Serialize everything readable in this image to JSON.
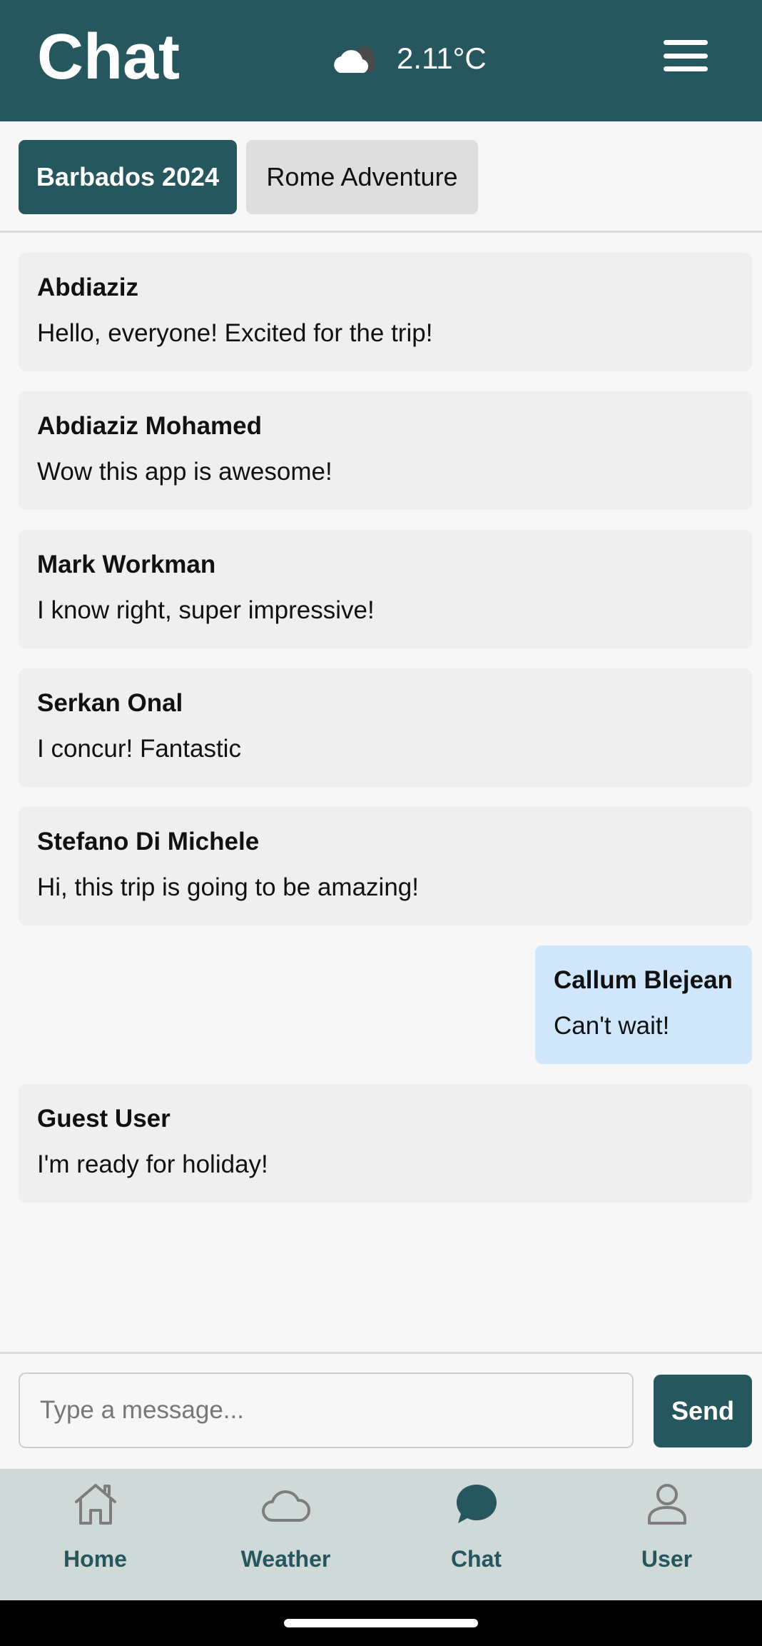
{
  "header": {
    "title": "Chat",
    "weather_icon": "cloud-icon",
    "temperature": "2.11°C",
    "menu_icon": "hamburger-menu-icon"
  },
  "tabs": [
    {
      "label": "Barbados 2024",
      "active": true
    },
    {
      "label": "Rome Adventure",
      "active": false
    }
  ],
  "messages": [
    {
      "sender": "Abdiaziz",
      "text": "Hello, everyone! Excited for the trip!",
      "own": false
    },
    {
      "sender": "Abdiaziz Mohamed",
      "text": "Wow this app is awesome!",
      "own": false
    },
    {
      "sender": "Mark Workman",
      "text": "I know right, super impressive!",
      "own": false
    },
    {
      "sender": "Serkan Onal",
      "text": "I concur! Fantastic",
      "own": false
    },
    {
      "sender": "Stefano Di Michele",
      "text": "Hi, this trip is going to be amazing!",
      "own": false
    },
    {
      "sender": "Callum Blejean",
      "text": "Can't wait!",
      "own": true
    },
    {
      "sender": "Guest User",
      "text": "I'm ready for holiday!",
      "own": false
    }
  ],
  "composer": {
    "placeholder": "Type a message...",
    "value": "",
    "send_label": "Send"
  },
  "bottom_nav": [
    {
      "label": "Home",
      "icon": "home-icon",
      "active": false
    },
    {
      "label": "Weather",
      "icon": "cloud-icon",
      "active": false
    },
    {
      "label": "Chat",
      "icon": "chat-bubble-icon",
      "active": true
    },
    {
      "label": "User",
      "icon": "user-icon",
      "active": false
    }
  ],
  "colors": {
    "primary": "#26575f",
    "own_message_bg": "#cfe6fb",
    "message_bg": "#efefef",
    "nav_bg": "#cfd9d8"
  }
}
